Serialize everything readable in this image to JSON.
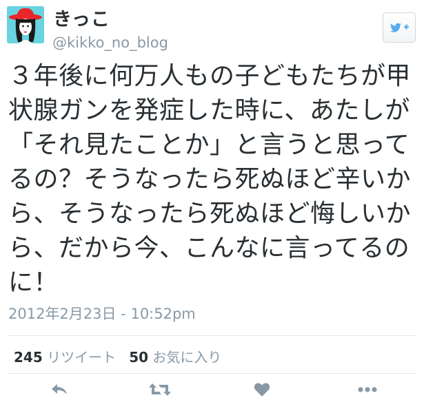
{
  "profile": {
    "display_name": "きっこ",
    "handle": "@kikko_no_blog",
    "avatar_icon": "avatar-icon"
  },
  "follow_button": {
    "icon": "twitter-follow-icon",
    "color": "#55acee"
  },
  "tweet": {
    "text": "３年後に何万人もの子どもたちが甲状腺ガンを発症した時に、あたしが「それ見たことか」と言うと思ってるの？そうなったら死ぬほど辛いから、そうなったら死ぬほど悔しいから、だから今、こんなに言ってるのに！",
    "timestamp": "2012年2月23日 - 10:52pm"
  },
  "stats": {
    "retweets_count": "245",
    "retweets_label": "リツイート",
    "favorites_count": "50",
    "favorites_label": "お気に入り"
  },
  "actions": [
    {
      "name": "reply-icon"
    },
    {
      "name": "retweet-icon"
    },
    {
      "name": "favorite-icon"
    },
    {
      "name": "more-icon"
    }
  ],
  "colors": {
    "text": "#292f33",
    "muted": "#8899a6",
    "action_icon": "#8899a6",
    "brand": "#55acee"
  }
}
